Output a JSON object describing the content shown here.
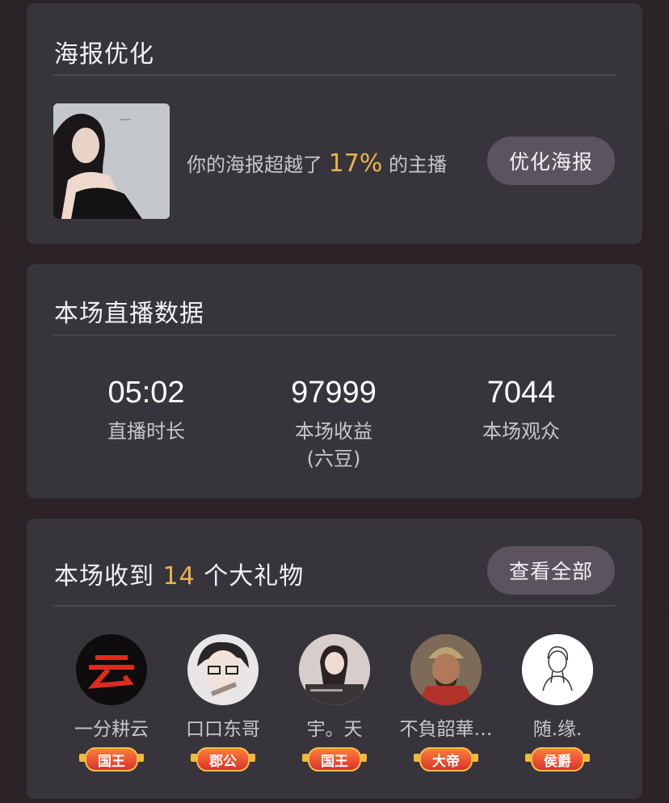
{
  "poster_card": {
    "title": "海报优化",
    "text_prefix": "你的海报超越了",
    "percent": "17%",
    "text_suffix": "的主播",
    "button": "优化海报"
  },
  "stats_card": {
    "title": "本场直播数据",
    "stats": [
      {
        "value": "05:02",
        "label": "直播时长",
        "sublabel": ""
      },
      {
        "value": "97999",
        "label": "本场收益",
        "sublabel": "(六豆)"
      },
      {
        "value": "7044",
        "label": "本场观众",
        "sublabel": ""
      }
    ]
  },
  "gifts_card": {
    "title_prefix": "本场收到",
    "count": "14",
    "title_suffix": "个大礼物",
    "button": "查看全部",
    "gifters": [
      {
        "name": "一分耕云",
        "badge": "国王"
      },
      {
        "name": "口口东哥",
        "badge": "郡公"
      },
      {
        "name": "宇。天",
        "badge": "国王"
      },
      {
        "name": "不負韶華…",
        "badge": "大帝"
      },
      {
        "name": "随.缘.",
        "badge": "侯爵"
      }
    ]
  },
  "colors": {
    "accent": "#e9b44c",
    "card": "#38343b",
    "pill": "#5b5460"
  }
}
